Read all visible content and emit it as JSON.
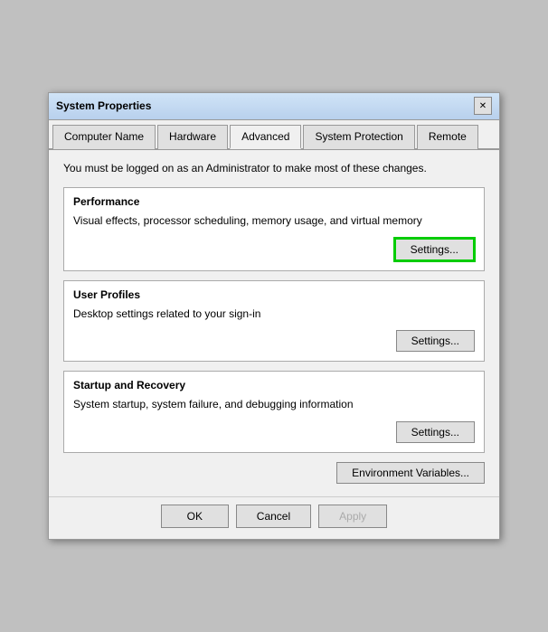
{
  "window": {
    "title": "System Properties",
    "close_label": "✕"
  },
  "tabs": [
    {
      "label": "Computer Name",
      "active": false
    },
    {
      "label": "Hardware",
      "active": false
    },
    {
      "label": "Advanced",
      "active": true
    },
    {
      "label": "System Protection",
      "active": false
    },
    {
      "label": "Remote",
      "active": false
    }
  ],
  "content": {
    "admin_notice": "You must be logged on as an Administrator to make most of these changes.",
    "performance": {
      "title": "Performance",
      "description": "Visual effects, processor scheduling, memory usage, and virtual memory",
      "settings_label": "Settings..."
    },
    "user_profiles": {
      "title": "User Profiles",
      "description": "Desktop settings related to your sign-in",
      "settings_label": "Settings..."
    },
    "startup_recovery": {
      "title": "Startup and Recovery",
      "description": "System startup, system failure, and debugging information",
      "settings_label": "Settings..."
    },
    "env_variables_label": "Environment Variables..."
  },
  "footer": {
    "ok_label": "OK",
    "cancel_label": "Cancel",
    "apply_label": "Apply"
  }
}
